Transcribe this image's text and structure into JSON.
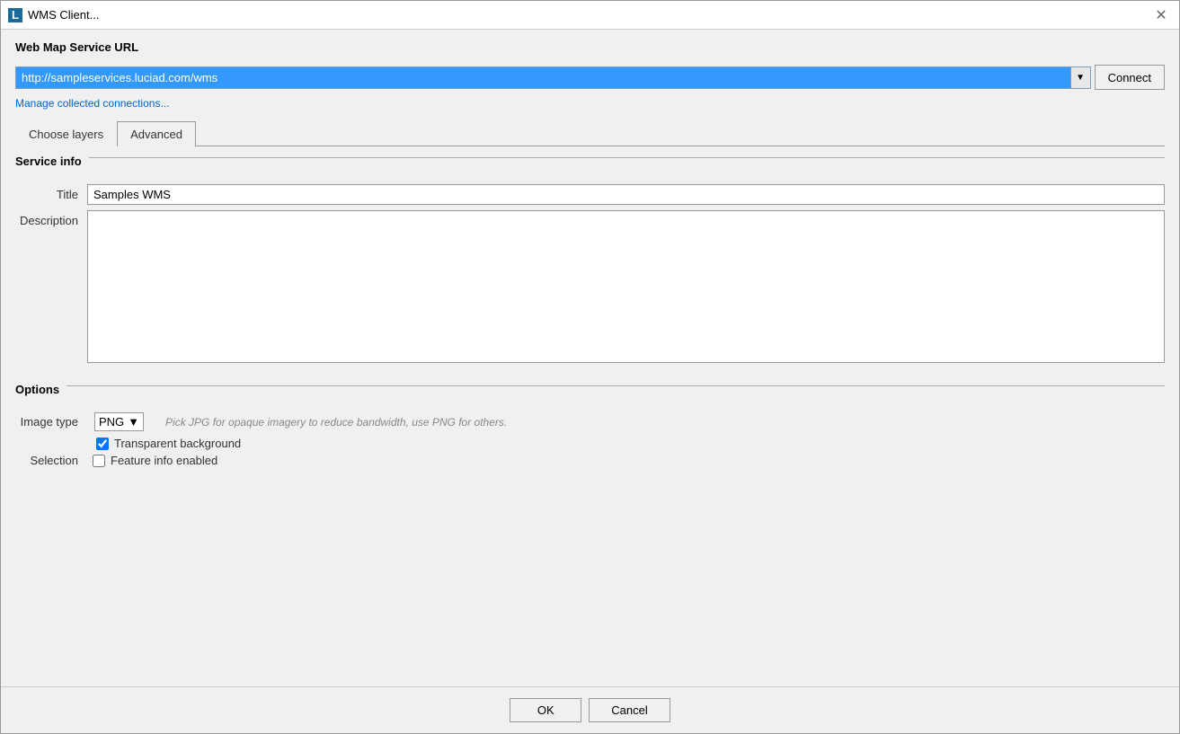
{
  "window": {
    "title": "WMS Client...",
    "icon_label": "L",
    "close_label": "✕"
  },
  "url_section": {
    "label": "Web Map Service URL",
    "url_value": "http://sampleservices.luciad.com/wms",
    "connect_label": "Connect",
    "manage_label": "Manage collected connections..."
  },
  "tabs": [
    {
      "id": "choose-layers",
      "label": "Choose layers",
      "active": false
    },
    {
      "id": "advanced",
      "label": "Advanced",
      "active": true
    }
  ],
  "service_info": {
    "section_title": "Service info",
    "title_label": "Title",
    "title_value": "Samples WMS",
    "description_label": "Description",
    "description_value": ""
  },
  "options": {
    "section_title": "Options",
    "image_type_label": "Image type",
    "image_type_value": "PNG",
    "image_type_hint": "Pick JPG for opaque imagery to reduce bandwidth, use PNG for others.",
    "transparent_bg_label": "Transparent background",
    "transparent_bg_checked": true,
    "selection_label": "Selection",
    "feature_info_label": "Feature info enabled",
    "feature_info_checked": false
  },
  "footer": {
    "ok_label": "OK",
    "cancel_label": "Cancel"
  }
}
